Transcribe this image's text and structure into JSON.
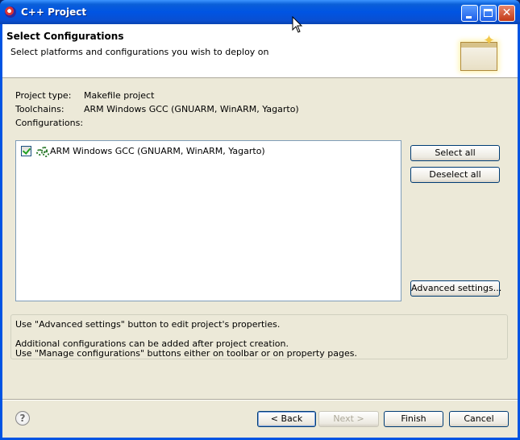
{
  "window": {
    "title": "C++ Project"
  },
  "banner": {
    "title": "Select Configurations",
    "description": "Select platforms and configurations you wish to deploy on"
  },
  "project_info": {
    "project_type_label": "Project type:",
    "project_type_value": "Makefile project",
    "toolchains_label": "Toolchains:",
    "toolchains_value": "ARM Windows GCC (GNUARM, WinARM, Yagarto)",
    "configurations_label": "Configurations:"
  },
  "configurations": [
    {
      "label": "ARM Windows GCC (GNUARM, WinARM, Yagarto)",
      "checked": true
    }
  ],
  "side_buttons": {
    "select_all": "Select all",
    "deselect_all": "Deselect all",
    "advanced_settings": "Advanced settings..."
  },
  "hints": {
    "line1": "Use \"Advanced settings\" button to edit project's properties.",
    "line2": "Additional configurations can be added after project creation.",
    "line3": "Use \"Manage configurations\" buttons either on toolbar or on property pages."
  },
  "footer": {
    "help_glyph": "?",
    "back_label": "< Back",
    "next_label": "Next >",
    "finish_label": "Finish",
    "cancel_label": "Cancel"
  },
  "colors": {
    "titlebar": "#0054e3",
    "dialog_bg": "#ece9d8",
    "list_border": "#7f9db9"
  }
}
